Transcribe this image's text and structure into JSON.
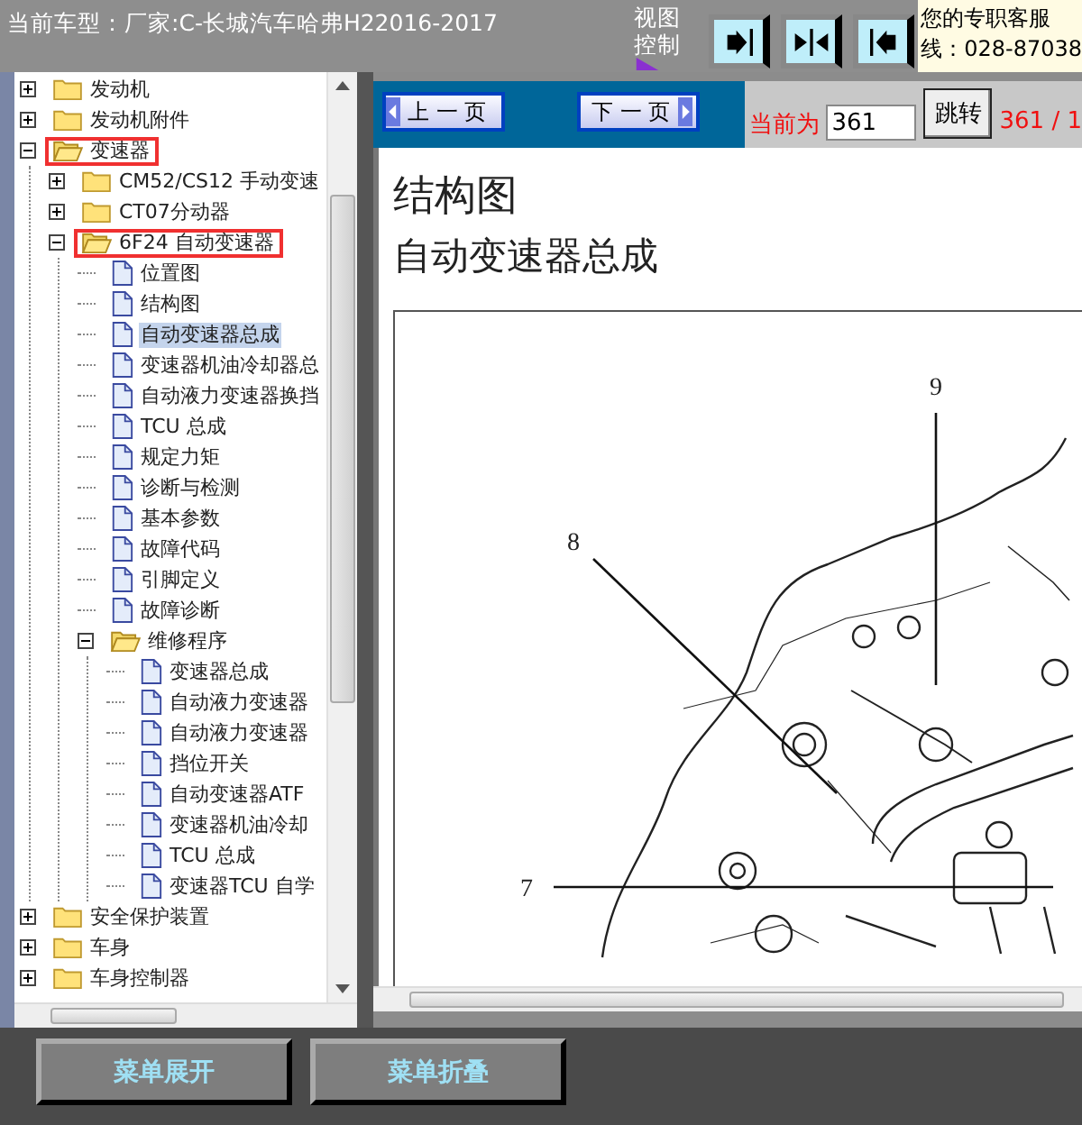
{
  "header": {
    "vehicle": "当前车型：厂家:C-长城汽车哈弗H22016-2017",
    "view_control": "视图控制"
  },
  "view_buttons": [
    {
      "kind": "expand-right"
    },
    {
      "kind": "split"
    },
    {
      "kind": "expand-left"
    }
  ],
  "support": {
    "line_1": "您的专职客服",
    "line_2": "线：028-87038"
  },
  "tree": [
    {
      "label": "发动机",
      "kind": "folder",
      "expanded": false,
      "selected": false,
      "marked": false
    },
    {
      "label": "发动机附件",
      "kind": "folder",
      "expanded": false,
      "selected": false,
      "marked": false
    },
    {
      "label": "变速器",
      "kind": "folder",
      "expanded": true,
      "selected": false,
      "marked": true,
      "children": [
        {
          "label": "CM52/CS12 手动变速",
          "kind": "folder",
          "expanded": false,
          "selected": false,
          "marked": false
        },
        {
          "label": "CT07分动器",
          "kind": "folder",
          "expanded": false,
          "selected": false,
          "marked": false
        },
        {
          "label": "6F24 自动变速器",
          "kind": "folder",
          "expanded": true,
          "selected": false,
          "marked": true,
          "children": [
            {
              "label": "位置图",
              "kind": "page",
              "selected": false,
              "marked": false
            },
            {
              "label": "结构图",
              "kind": "page",
              "selected": false,
              "marked": false
            },
            {
              "label": "自动变速器总成",
              "kind": "page",
              "selected": true,
              "marked": false
            },
            {
              "label": "变速器机油冷却器总",
              "kind": "page",
              "selected": false,
              "marked": false
            },
            {
              "label": "自动液力变速器换挡",
              "kind": "page",
              "selected": false,
              "marked": false
            },
            {
              "label": "TCU 总成",
              "kind": "page",
              "selected": false,
              "marked": false
            },
            {
              "label": "规定力矩",
              "kind": "page",
              "selected": false,
              "marked": false
            },
            {
              "label": "诊断与检测",
              "kind": "page",
              "selected": false,
              "marked": false
            },
            {
              "label": "基本参数",
              "kind": "page",
              "selected": false,
              "marked": false
            },
            {
              "label": "故障代码",
              "kind": "page",
              "selected": false,
              "marked": false
            },
            {
              "label": "引脚定义",
              "kind": "page",
              "selected": false,
              "marked": false
            },
            {
              "label": "故障诊断",
              "kind": "page",
              "selected": false,
              "marked": false
            },
            {
              "label": "维修程序",
              "kind": "folder",
              "expanded": true,
              "selected": false,
              "marked": false,
              "children": [
                {
                  "label": "变速器总成",
                  "kind": "page",
                  "selected": false,
                  "marked": false
                },
                {
                  "label": "自动液力变速器",
                  "kind": "page",
                  "selected": false,
                  "marked": false
                },
                {
                  "label": "自动液力变速器",
                  "kind": "page",
                  "selected": false,
                  "marked": false
                },
                {
                  "label": "挡位开关",
                  "kind": "page",
                  "selected": false,
                  "marked": false
                },
                {
                  "label": "自动变速器ATF",
                  "kind": "page",
                  "selected": false,
                  "marked": false
                },
                {
                  "label": "变速器机油冷却",
                  "kind": "page",
                  "selected": false,
                  "marked": false
                },
                {
                  "label": "TCU 总成",
                  "kind": "page",
                  "selected": false,
                  "marked": false
                },
                {
                  "label": "变速器TCU 自学",
                  "kind": "page",
                  "selected": false,
                  "marked": false
                }
              ]
            }
          ]
        }
      ]
    },
    {
      "label": "安全保护装置",
      "kind": "folder",
      "expanded": false,
      "selected": false,
      "marked": false
    },
    {
      "label": "车身",
      "kind": "folder",
      "expanded": false,
      "selected": false,
      "marked": false
    },
    {
      "label": "车身控制器",
      "kind": "folder",
      "expanded": false,
      "selected": false,
      "marked": false
    }
  ],
  "nav": {
    "prev": "上 一 页",
    "next": "下 一 页",
    "current_label": "当前为",
    "page_input": "361",
    "jump": "跳转",
    "page_count": "361 / 1"
  },
  "document": {
    "title": "结构图",
    "subtitle": "自动变速器总成",
    "callouts": [
      {
        "label": "9"
      },
      {
        "label": "8"
      },
      {
        "label": "7"
      }
    ]
  },
  "footer_buttons": [
    "菜单展开",
    "菜单折叠"
  ]
}
